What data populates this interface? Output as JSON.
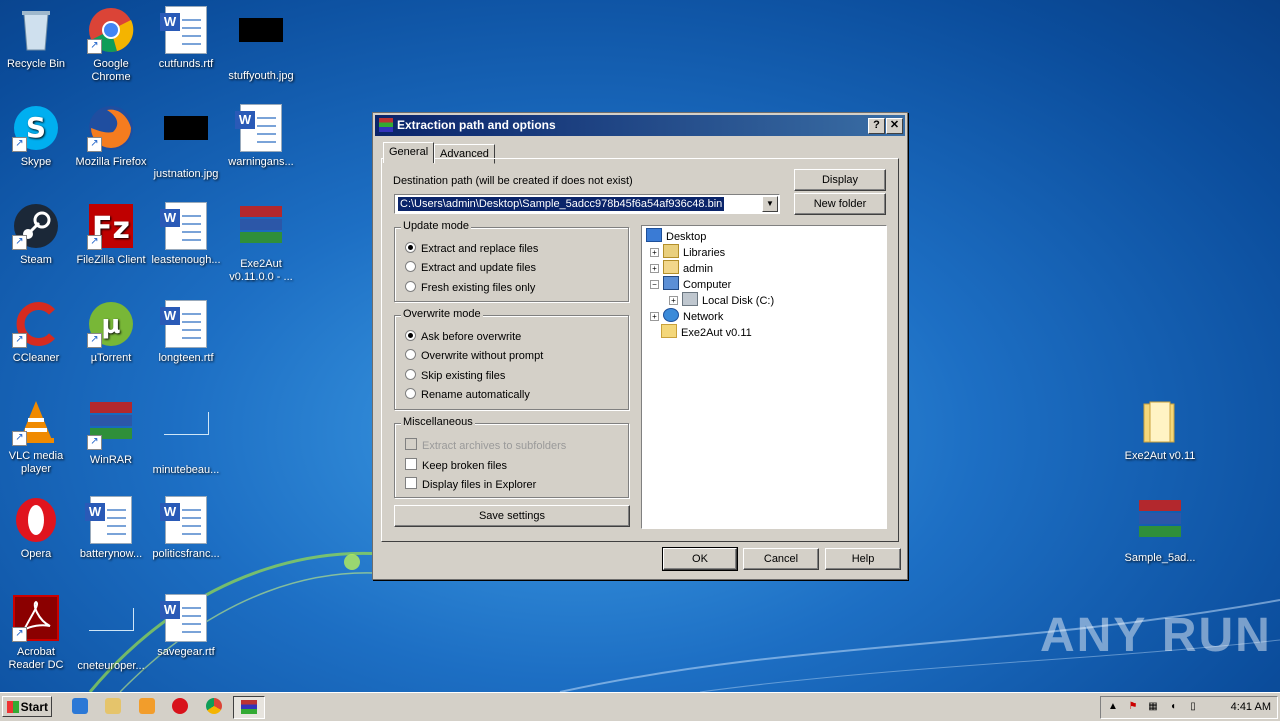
{
  "desktop": {
    "icons": [
      {
        "label": "Recycle Bin"
      },
      {
        "label": "Google Chrome"
      },
      {
        "label": "cutfunds.rtf"
      },
      {
        "label": "stuffyouth.jpg"
      },
      {
        "label": "Skype"
      },
      {
        "label": "Mozilla Firefox"
      },
      {
        "label": "justnation.jpg"
      },
      {
        "label": "warningans..."
      },
      {
        "label": "Steam"
      },
      {
        "label": "FileZilla Client"
      },
      {
        "label": "leastenough..."
      },
      {
        "label": "Exe2Aut v0.11.0.0 - ..."
      },
      {
        "label": "CCleaner"
      },
      {
        "label": "µTorrent"
      },
      {
        "label": "longteen.rtf"
      },
      {
        "label": "VLC media player"
      },
      {
        "label": "WinRAR"
      },
      {
        "label": "minutebeau..."
      },
      {
        "label": "Opera"
      },
      {
        "label": "batterynow..."
      },
      {
        "label": "politicsfranc..."
      },
      {
        "label": "Acrobat Reader DC"
      },
      {
        "label": "cneteuroper..."
      },
      {
        "label": "savegear.rtf"
      },
      {
        "label": "Exe2Aut v0.11"
      },
      {
        "label": "Sample_5ad..."
      }
    ]
  },
  "dialog": {
    "title": "Extraction path and options",
    "help_btn": "?",
    "close_btn": "✕",
    "tabs": [
      "General",
      "Advanced"
    ],
    "dest_label": "Destination path (will be created if does not exist)",
    "dest_value": "C:\\Users\\admin\\Desktop\\Sample_5adcc978b45f6a54af936c48.bin",
    "display_btn": "Display",
    "new_folder_btn": "New folder",
    "update_mode": {
      "title": "Update mode",
      "options": [
        "Extract and replace files",
        "Extract and update files",
        "Fresh existing files only"
      ],
      "selected": 0
    },
    "overwrite_mode": {
      "title": "Overwrite mode",
      "options": [
        "Ask before overwrite",
        "Overwrite without prompt",
        "Skip existing files",
        "Rename automatically"
      ],
      "selected": 0
    },
    "misc": {
      "title": "Miscellaneous",
      "options": [
        "Extract archives to subfolders",
        "Keep broken files",
        "Display files in Explorer"
      ],
      "checked": [
        false,
        false,
        false
      ],
      "disabled": [
        true,
        false,
        false
      ]
    },
    "save_btn": "Save settings",
    "tree": [
      "Desktop",
      "Libraries",
      "admin",
      "Computer",
      "Local Disk (C:)",
      "Network",
      "Exe2Aut v0.11"
    ],
    "ok_btn": "OK",
    "cancel_btn": "Cancel",
    "helpbtn": "Help"
  },
  "taskbar": {
    "start": "Start",
    "clock": "4:41 AM"
  },
  "watermark": "ANY RUN",
  "colors": {
    "title_start": "#0a246a",
    "title_end": "#3a6ea5",
    "face": "#d4d0c8"
  }
}
